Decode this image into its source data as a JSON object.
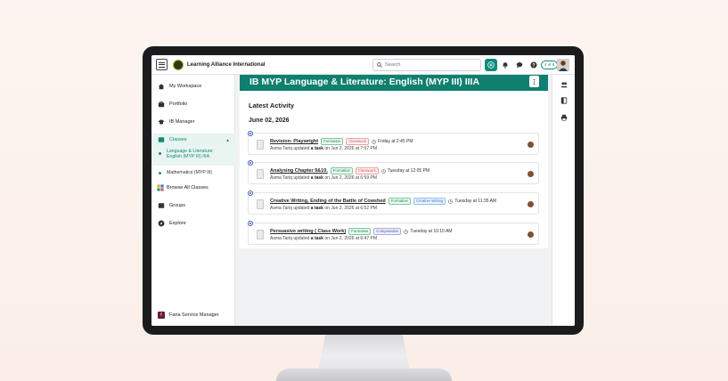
{
  "header": {
    "app_name": "Learning Alliance International",
    "search_placeholder": "Search",
    "pager": "4 of 6"
  },
  "sidebar": {
    "items": [
      {
        "label": "My Workspace",
        "icon": "home-icon"
      },
      {
        "label": "Portfolio",
        "icon": "portfolio-icon"
      },
      {
        "label": "IB Manager",
        "icon": "ib-icon"
      },
      {
        "label": "Classes",
        "icon": "classes-icon"
      },
      {
        "label": "Browse All Classes",
        "icon": "grid-icon"
      },
      {
        "label": "Groups",
        "icon": "groups-icon"
      },
      {
        "label": "Explore",
        "icon": "compass-icon"
      }
    ],
    "classes": [
      {
        "label_line1": "Language & Literature:",
        "label_line2": "English (MYP III) IIIA"
      },
      {
        "label": "Mathematics (MYP III)"
      }
    ],
    "footer": "Faria Service Manager"
  },
  "main": {
    "banner_title": "IB MYP Language & Literature: English (MYP III) IIIA",
    "section_title": "Latest Activity",
    "date": "June 02, 2026",
    "activities": [
      {
        "title": "Revision- Playwright",
        "tags": [
          "Formative",
          "Classwork"
        ],
        "due": "Friday at 2:45 PM",
        "user": "Asma Tariq",
        "verb": "updated",
        "object": "a task",
        "timestamp": "on Jun 2, 2026 at 7:07 PM"
      },
      {
        "title": "Analysing Chapter 9&10.",
        "tags": [
          "Formative",
          "Classwork"
        ],
        "due": "Tuesday at 12:05 PM",
        "user": "Asma Tariq",
        "verb": "updated",
        "object": "a task",
        "timestamp": "on Jun 2, 2026 at 6:59 PM"
      },
      {
        "title": "Creative Writing, Ending of the Battle of Cowshed",
        "tags": [
          "Formative",
          "Creative Writing"
        ],
        "due": "Tuesday at 11:35 AM",
        "user": "Asma Tariq",
        "verb": "updated",
        "object": "a task",
        "timestamp": "on Jun 2, 2026 at 6:52 PM"
      },
      {
        "title": "Persuasive writing ( Class Work)",
        "tags": [
          "Formative",
          "Composative"
        ],
        "due": "Tuesday at 10:10 AM",
        "user": "Asma Tariq",
        "verb": "updated",
        "object": "a task",
        "timestamp": "on Jun 2, 2026 at 6:47 PM"
      }
    ]
  },
  "colors": {
    "accent": "#0f7f70",
    "banner": "#0f7f70"
  }
}
